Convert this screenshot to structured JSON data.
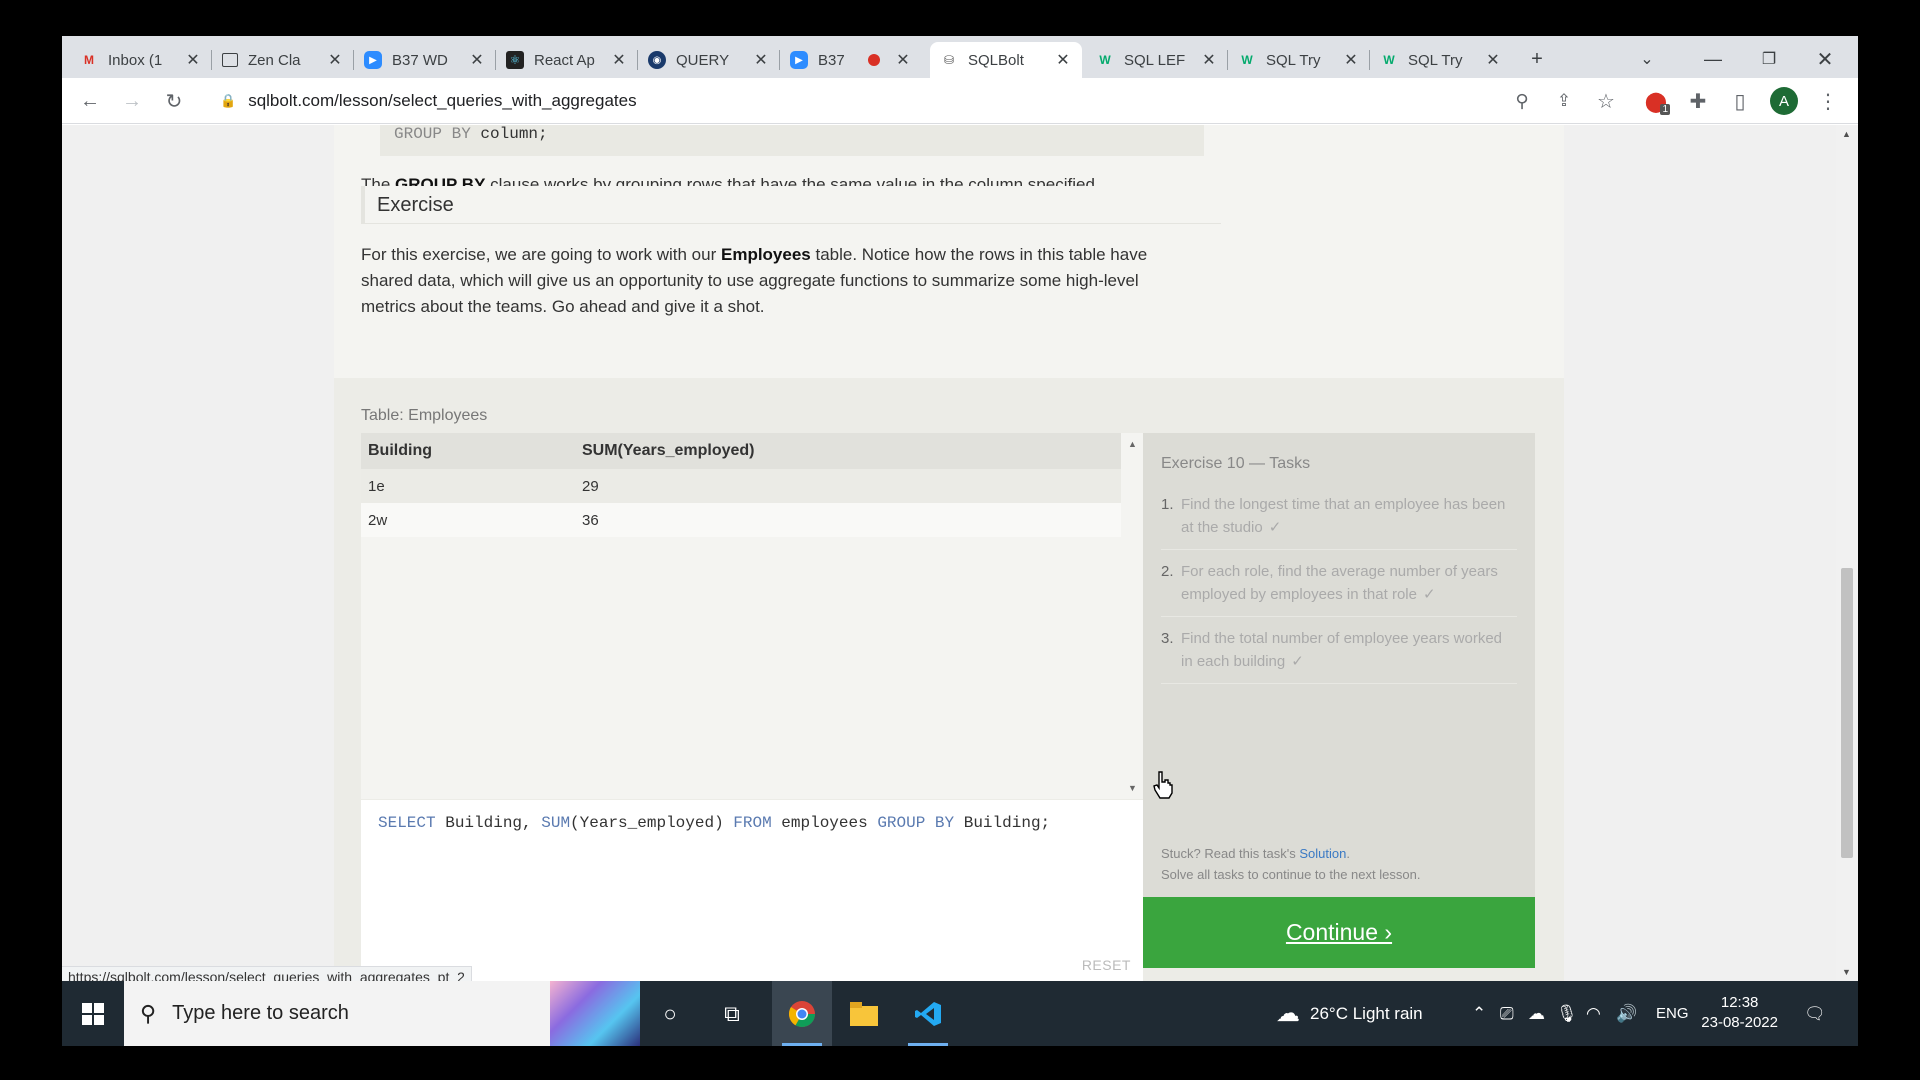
{
  "browser": {
    "tabs": [
      {
        "title": "Inbox (1",
        "icon": "gmail-icon",
        "active": false
      },
      {
        "title": "Zen Cla",
        "icon": "page-icon",
        "active": false
      },
      {
        "title": "B37 WD",
        "icon": "zoom-icon",
        "active": false
      },
      {
        "title": "React Ap",
        "icon": "react-icon",
        "active": false
      },
      {
        "title": "QUERY",
        "icon": "db-icon",
        "active": false
      },
      {
        "title": "B37",
        "icon": "zoom-icon",
        "active": false
      },
      {
        "title": "SQLBolt",
        "icon": "sqlbolt-icon",
        "active": true
      },
      {
        "title": "SQL LEF",
        "icon": "w3-icon",
        "active": false
      },
      {
        "title": "SQL Try",
        "icon": "w3-icon",
        "active": false
      },
      {
        "title": "SQL Try",
        "icon": "w3-icon",
        "active": false
      }
    ],
    "url": "sqlbolt.com/lesson/select_queries_with_aggregates",
    "avatar_letter": "A",
    "extension_badge": "1",
    "hover_link": "https://sqlbolt.com/lesson/select_queries_with_aggregates_pt_2"
  },
  "lesson": {
    "code_keyword": "GROUP BY",
    "code_column": "column;",
    "groupby_pre": "The ",
    "groupby_bold": "GROUP BY",
    "groupby_post": " clause works by grouping rows that have the same value in the column specified.",
    "exercise_heading": "Exercise",
    "exercise_pre": "For this exercise, we are going to work with our ",
    "exercise_bold": "Employees",
    "exercise_post1": " table. Notice how the rows in this table have",
    "exercise_line2": "shared data, which will give us an opportunity to use aggregate functions to summarize some high-level",
    "exercise_line3": "metrics about the teams. Go ahead and give it a shot."
  },
  "exercise": {
    "table_caption": "Table: Employees",
    "columns": [
      "Building",
      "SUM(Years_employed)"
    ],
    "rows": [
      [
        "1e",
        "29"
      ],
      [
        "2w",
        "36"
      ]
    ],
    "query_parts": {
      "select": "SELECT",
      "cols": " Building, ",
      "sum": "SUM",
      "arg": "(Years_employed) ",
      "from": "FROM",
      "table": " employees ",
      "groupby": "GROUP BY",
      "tail": " Building;"
    },
    "reset_label": "RESET",
    "tasks_title": "Exercise 10 — Tasks",
    "tasks": [
      {
        "num": "1.",
        "text": "Find the longest time that an employee has been at the studio",
        "check": "✓"
      },
      {
        "num": "2.",
        "text": "For each role, find the average number of years employed by employees in that role",
        "check": "✓"
      },
      {
        "num": "3.",
        "text": "Find the total number of employee years worked in each building",
        "check": "✓"
      }
    ],
    "help_pre": "Stuck? Read this task's ",
    "help_link": "Solution",
    "help_post": ".",
    "help_line2": "Solve all tasks to continue to the next lesson.",
    "continue_label": "Continue ›"
  },
  "taskbar": {
    "search_placeholder": "Type here to search",
    "weather": "26°C  Light rain",
    "language": "ENG",
    "time": "12:38",
    "date": "23-08-2022"
  }
}
